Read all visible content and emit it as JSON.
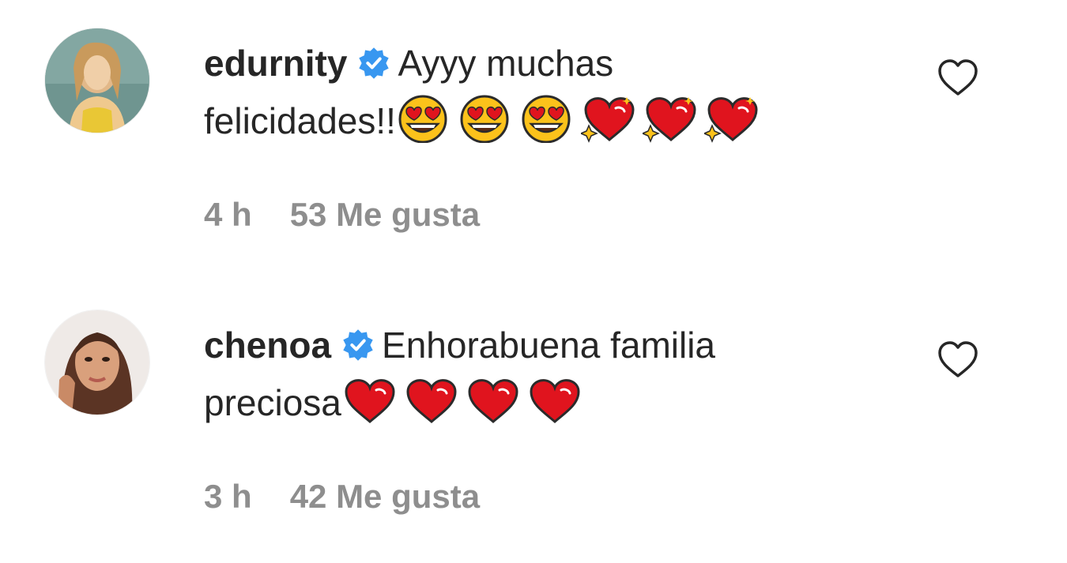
{
  "comments": [
    {
      "username": "edurnity",
      "verified": true,
      "text_line1": "Ayyy muchas",
      "text_line2": "felicidades!!",
      "emojis": [
        "heart-eyes-emoji",
        "heart-eyes-emoji",
        "heart-eyes-emoji",
        "sparkling-heart-emoji",
        "sparkling-heart-emoji",
        "sparkling-heart-emoji"
      ],
      "time": "4 h",
      "likes": "53 Me gusta"
    },
    {
      "username": "chenoa",
      "verified": true,
      "text_line1": "Enhorabuena familia",
      "text_line2": "preciosa",
      "emojis": [
        "red-heart-emoji",
        "red-heart-emoji",
        "red-heart-emoji",
        "red-heart-emoji"
      ],
      "time": "3 h",
      "likes": "42 Me gusta"
    }
  ],
  "colors": {
    "text": "#262626",
    "secondary": "#8e8e8e",
    "verified": "#3897f0",
    "heart_red": "#e0141e"
  }
}
